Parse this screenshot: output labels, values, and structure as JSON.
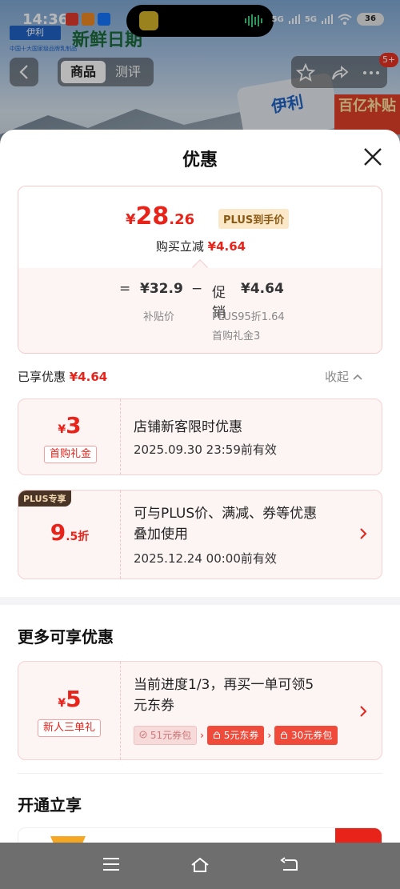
{
  "status_bar": {
    "time": "14:36",
    "signal1": "5G",
    "signal2": "5G",
    "battery": "36"
  },
  "background": {
    "brand_logo": "伊利",
    "brand_text": "新鲜日期",
    "tagline": "中国十大国家级品牌乳制品",
    "package_text": "伊利",
    "promo_text": "百亿补贴"
  },
  "top_nav": {
    "tabs": [
      {
        "label": "商品",
        "active": true
      },
      {
        "label": "测评",
        "active": false
      }
    ],
    "badge": "5+"
  },
  "sheet": {
    "title": "优惠",
    "price": {
      "currency": "¥",
      "integer": "28",
      "decimal": ".26",
      "plus_tag": "PLUS到手价",
      "reduce_label": "购买立减",
      "reduce_value": "¥4.64"
    },
    "formula": {
      "eq": "=",
      "base_price": "¥32.9",
      "minus": "−",
      "promo_label": "促销",
      "promo_value": "¥4.64",
      "base_label": "补贴价",
      "detail1": "PLUS95折1.64",
      "detail2": "首购礼金3"
    },
    "enjoyed": {
      "label": "已享优惠",
      "value": "¥4.64",
      "collapse": "收起"
    },
    "coupons": [
      {
        "amount_symbol": "¥",
        "amount": "3",
        "tag": "首购礼金",
        "title": "店铺新客限时优惠",
        "validity": "2025.09.30 23:59前有效"
      },
      {
        "corner": "PLUS专享",
        "amount": "9",
        "amount_suffix": ".5折",
        "title_line1": "可与PLUS价、满减、券等优惠",
        "title_line2": "叠加使用",
        "validity": "2025.12.24 00:00前有效"
      }
    ],
    "more_section": {
      "title": "更多可享优惠",
      "card": {
        "amount_symbol": "¥",
        "amount": "5",
        "tag": "新人三单礼",
        "title_line1": "当前进度1/3，再买一单可领5",
        "title_line2": "元东券",
        "chips": [
          "51元券包",
          "5元东券",
          "30元券包"
        ]
      }
    },
    "open_section": {
      "title": "开通立享"
    }
  },
  "colors": {
    "accent_red": "#e8231a",
    "plus_gold": "#8a5a14",
    "card_bg": "#fdf4f4"
  }
}
